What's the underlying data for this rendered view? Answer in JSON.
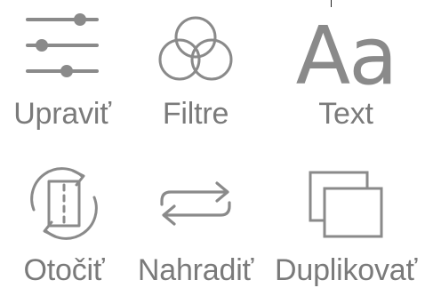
{
  "tools": {
    "edit": {
      "label": "Upraviť",
      "icon": "sliders-icon"
    },
    "filter": {
      "label": "Filtre",
      "icon": "filter-circles-icon"
    },
    "text": {
      "label": "Text",
      "icon": "text-aa-icon",
      "glyph": "Aa"
    },
    "rotate": {
      "label": "Otočiť",
      "icon": "rotate-icon"
    },
    "replace": {
      "label": "Nahradiť",
      "icon": "replace-arrows-icon"
    },
    "duplicate": {
      "label": "Duplikovať",
      "icon": "duplicate-icon"
    }
  },
  "colors": {
    "icon": "#8a8a8a",
    "label": "#7a7a7a",
    "background": "#ffffff"
  }
}
